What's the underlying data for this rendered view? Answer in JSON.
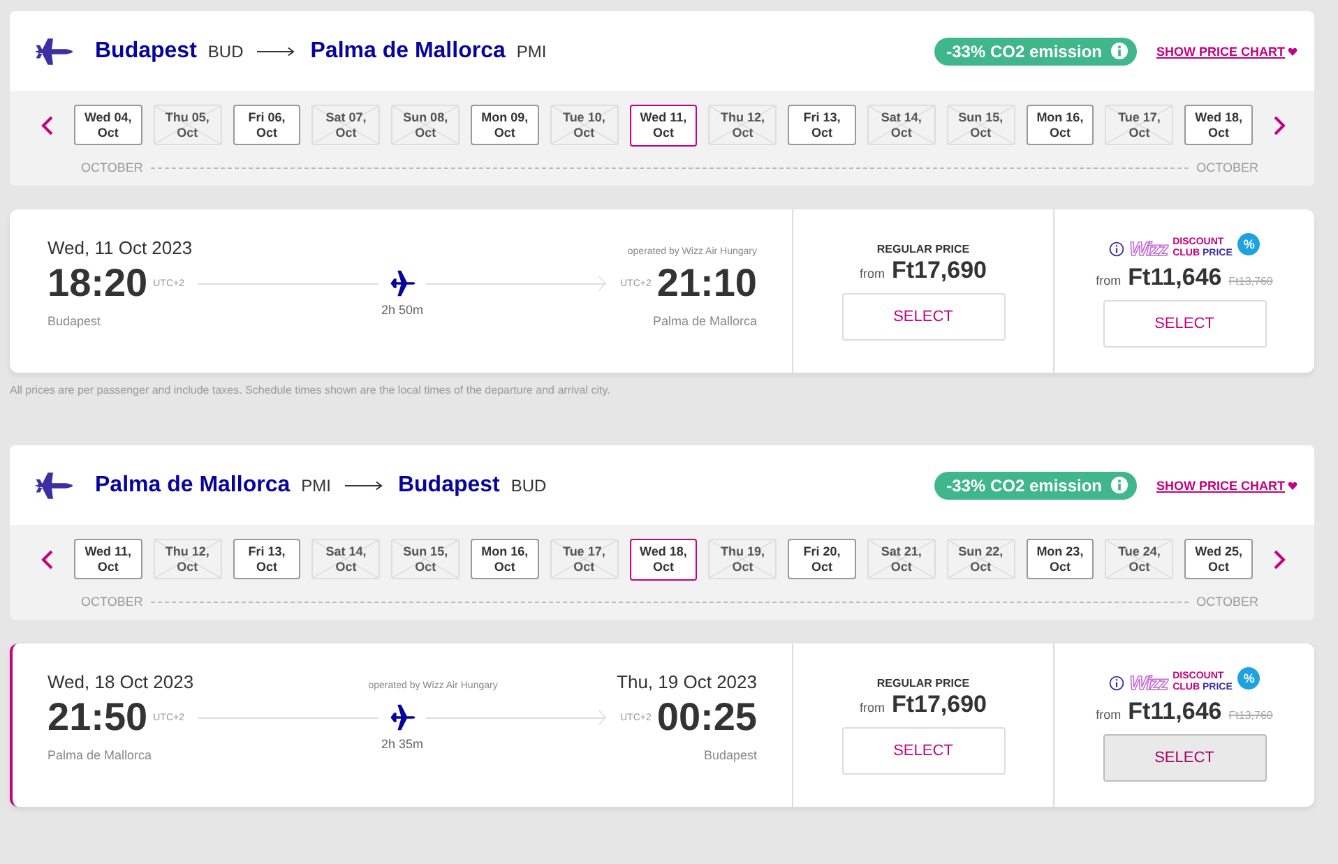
{
  "journeys": [
    {
      "origin": {
        "city": "Budapest",
        "code": "BUD"
      },
      "destination": {
        "city": "Palma de Mallorca",
        "code": "PMI"
      },
      "co2_badge": "-33% CO2 emission",
      "price_chart_link": "SHOW PRICE CHART",
      "dates": [
        {
          "label": "Wed 04, Oct",
          "available": true,
          "selected": false
        },
        {
          "label": "Thu 05, Oct",
          "available": false,
          "selected": false
        },
        {
          "label": "Fri 06, Oct",
          "available": true,
          "selected": false
        },
        {
          "label": "Sat 07, Oct",
          "available": false,
          "selected": false
        },
        {
          "label": "Sun 08, Oct",
          "available": false,
          "selected": false
        },
        {
          "label": "Mon 09, Oct",
          "available": true,
          "selected": false
        },
        {
          "label": "Tue 10, Oct",
          "available": false,
          "selected": false
        },
        {
          "label": "Wed 11, Oct",
          "available": true,
          "selected": true
        },
        {
          "label": "Thu 12, Oct",
          "available": false,
          "selected": false
        },
        {
          "label": "Fri 13, Oct",
          "available": true,
          "selected": false
        },
        {
          "label": "Sat 14, Oct",
          "available": false,
          "selected": false
        },
        {
          "label": "Sun 15, Oct",
          "available": false,
          "selected": false
        },
        {
          "label": "Mon 16, Oct",
          "available": true,
          "selected": false
        },
        {
          "label": "Tue 17, Oct",
          "available": false,
          "selected": false
        },
        {
          "label": "Wed 18, Oct",
          "available": true,
          "selected": false
        }
      ],
      "month_left": "OCTOBER",
      "month_right": "OCTOBER",
      "flight": {
        "selected": false,
        "departure_date": "Wed, 11 Oct 2023",
        "operator": "operated by Wizz Air Hungary",
        "departure_time": "18:20",
        "departure_tz": "UTC+2",
        "arrival_tz": "UTC+2",
        "arrival_time": "21:10",
        "departure_city": "Budapest",
        "duration": "2h 50m",
        "arrival_city": "Palma de Mallorca",
        "regular": {
          "label": "REGULAR PRICE",
          "from": "from",
          "price": "Ft17,690",
          "button": "SELECT",
          "button_selected": false
        },
        "discount": {
          "logo": "Wizz",
          "label_1": "DISCOUNT",
          "label_2a": "CLUB",
          "label_2b": "PRICE",
          "badge": "%",
          "from": "from",
          "price": "Ft11,646",
          "old_price": "Ft13,760",
          "button": "SELECT",
          "button_selected": false
        }
      },
      "note": "All prices are per passenger and include taxes. Schedule times shown are the local times of the departure and arrival city."
    },
    {
      "origin": {
        "city": "Palma de Mallorca",
        "code": "PMI"
      },
      "destination": {
        "city": "Budapest",
        "code": "BUD"
      },
      "co2_badge": "-33% CO2 emission",
      "price_chart_link": "SHOW PRICE CHART",
      "dates": [
        {
          "label": "Wed 11, Oct",
          "available": true,
          "selected": false
        },
        {
          "label": "Thu 12, Oct",
          "available": false,
          "selected": false
        },
        {
          "label": "Fri 13, Oct",
          "available": true,
          "selected": false
        },
        {
          "label": "Sat 14, Oct",
          "available": false,
          "selected": false
        },
        {
          "label": "Sun 15, Oct",
          "available": false,
          "selected": false
        },
        {
          "label": "Mon 16, Oct",
          "available": true,
          "selected": false
        },
        {
          "label": "Tue 17, Oct",
          "available": false,
          "selected": false
        },
        {
          "label": "Wed 18, Oct",
          "available": true,
          "selected": true
        },
        {
          "label": "Thu 19, Oct",
          "available": false,
          "selected": false
        },
        {
          "label": "Fri 20, Oct",
          "available": true,
          "selected": false
        },
        {
          "label": "Sat 21, Oct",
          "available": false,
          "selected": false
        },
        {
          "label": "Sun 22, Oct",
          "available": false,
          "selected": false
        },
        {
          "label": "Mon 23, Oct",
          "available": true,
          "selected": false
        },
        {
          "label": "Tue 24, Oct",
          "available": false,
          "selected": false
        },
        {
          "label": "Wed 25, Oct",
          "available": true,
          "selected": false
        }
      ],
      "month_left": "OCTOBER",
      "month_right": "OCTOBER",
      "flight": {
        "selected": true,
        "departure_date": "Wed, 18 Oct 2023",
        "operator": "operated by Wizz Air Hungary",
        "arrival_date": "Thu, 19 Oct 2023",
        "departure_time": "21:50",
        "departure_tz": "UTC+2",
        "arrival_tz": "UTC+2",
        "arrival_time": "00:25",
        "departure_city": "Palma de Mallorca",
        "duration": "2h 35m",
        "arrival_city": "Budapest",
        "regular": {
          "label": "REGULAR PRICE",
          "from": "from",
          "price": "Ft17,690",
          "button": "SELECT",
          "button_selected": false
        },
        "discount": {
          "logo": "Wizz",
          "label_1": "DISCOUNT",
          "label_2a": "CLUB",
          "label_2b": "PRICE",
          "badge": "%",
          "from": "from",
          "price": "Ft11,646",
          "old_price": "Ft13,760",
          "button": "SELECT",
          "button_selected": true
        }
      }
    }
  ]
}
